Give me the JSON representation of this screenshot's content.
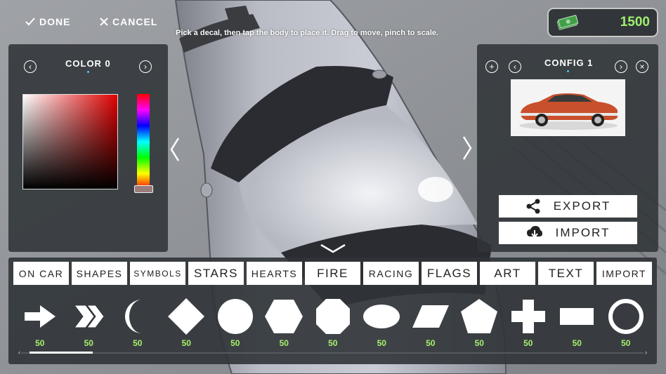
{
  "topbar": {
    "done_label": "DONE",
    "cancel_label": "CANCEL",
    "hint": "Pick a decal, then tap the body to place it. Drag to move, pinch to scale.",
    "money": "1500"
  },
  "color_panel": {
    "title": "COLOR 0",
    "prev_icon": "‹",
    "next_icon": "›"
  },
  "config_panel": {
    "title": "CONFIG 1",
    "add_icon": "+",
    "prev_icon": "‹",
    "next_icon": "›",
    "close_icon": "×",
    "export_label": "EXPORT",
    "import_label": "IMPORT"
  },
  "tabs": [
    {
      "label": "ON CAR",
      "size": "normal"
    },
    {
      "label": "SHAPES",
      "size": "normal"
    },
    {
      "label": "SYMBOLS",
      "size": "small"
    },
    {
      "label": "STARS",
      "size": "big"
    },
    {
      "label": "HEARTS",
      "size": "normal"
    },
    {
      "label": "FIRE",
      "size": "big"
    },
    {
      "label": "RACING",
      "size": "normal"
    },
    {
      "label": "FLAGS",
      "size": "big"
    },
    {
      "label": "ART",
      "size": "big"
    },
    {
      "label": "TEXT",
      "size": "big"
    },
    {
      "label": "IMPORT",
      "size": "normal"
    }
  ],
  "shapes": [
    {
      "shape": "arrow",
      "price": "50"
    },
    {
      "shape": "double-chevron",
      "price": "50"
    },
    {
      "shape": "crescent",
      "price": "50"
    },
    {
      "shape": "diamond",
      "price": "50"
    },
    {
      "shape": "circle",
      "price": "50"
    },
    {
      "shape": "hexagon",
      "price": "50"
    },
    {
      "shape": "octagon",
      "price": "50"
    },
    {
      "shape": "ellipse",
      "price": "50"
    },
    {
      "shape": "parallelogram",
      "price": "50"
    },
    {
      "shape": "pentagon",
      "price": "50"
    },
    {
      "shape": "plus",
      "price": "50"
    },
    {
      "shape": "rectangle",
      "price": "50"
    },
    {
      "shape": "ring",
      "price": "50"
    }
  ],
  "scroll_position": 0.0,
  "colors": {
    "accent_green": "#9ff06c",
    "panel_bg": "#303438",
    "picked_hue": "#e00000"
  }
}
